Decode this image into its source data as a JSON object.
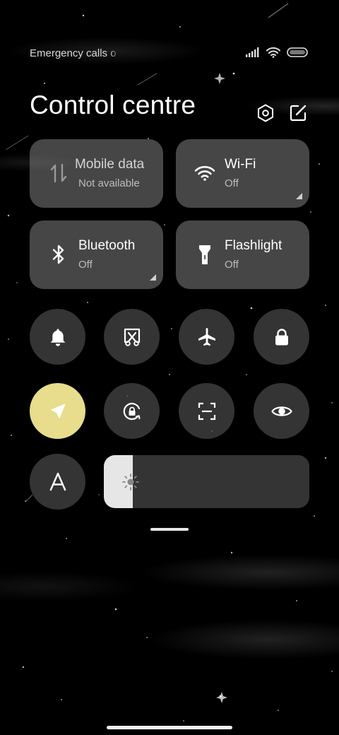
{
  "status_bar": {
    "text": "Emergency calls o",
    "icons": [
      "signal-icon",
      "wifi-icon",
      "battery-icon"
    ]
  },
  "header": {
    "title": "Control centre",
    "icons": [
      "settings-icon",
      "edit-icon"
    ]
  },
  "tiles": [
    {
      "name": "Mobile data",
      "state": "Not available",
      "icon": "mobile-data-icon"
    },
    {
      "name": "Wi-Fi",
      "state": "Off",
      "icon": "wifi-icon"
    },
    {
      "name": "Bluetooth",
      "state": "Off",
      "icon": "bluetooth-icon"
    },
    {
      "name": "Flashlight",
      "state": "Off",
      "icon": "flashlight-icon"
    }
  ],
  "toggles_row1": [
    "bell-icon",
    "screenshot-icon",
    "airplane-icon",
    "lock-icon"
  ],
  "toggles_row2": [
    "location-icon",
    "rotation-lock-icon",
    "scan-icon",
    "eye-icon"
  ],
  "text_size_button": {
    "label": "A",
    "icon": "font-size-icon"
  },
  "brightness": {
    "level_percent": 14,
    "icon": "brightness-icon"
  },
  "colors": {
    "tile_bg": "#7d7d7d",
    "button_bg": "#5a5a5a",
    "active_accent": "#e7dd8c",
    "slider_fill": "#e6e6e6"
  }
}
